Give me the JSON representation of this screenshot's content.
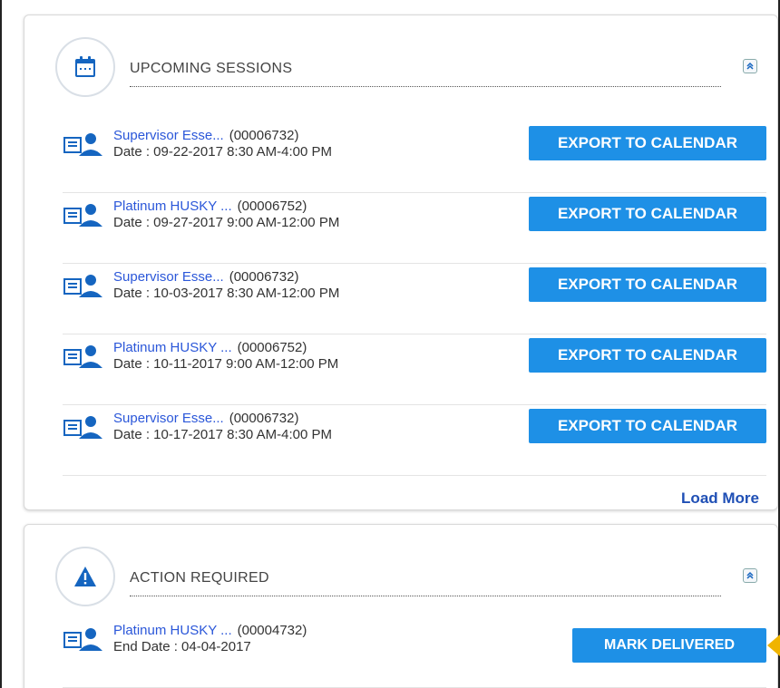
{
  "upcoming": {
    "title": "UPCOMING SESSIONS",
    "sessions": [
      {
        "name": "Supervisor Esse...",
        "code": "(00006732)",
        "date": "Date : 09-22-2017 8:30 AM-4:00 PM",
        "button": "EXPORT TO CALENDAR"
      },
      {
        "name": "Platinum HUSKY ...",
        "code": "(00006752)",
        "date": "Date : 09-27-2017 9:00 AM-12:00 PM",
        "button": "EXPORT TO CALENDAR"
      },
      {
        "name": "Supervisor Esse...",
        "code": "(00006732)",
        "date": "Date : 10-03-2017 8:30 AM-12:00 PM",
        "button": "EXPORT TO CALENDAR"
      },
      {
        "name": "Platinum HUSKY ...",
        "code": "(00006752)",
        "date": "Date : 10-11-2017 9:00 AM-12:00 PM",
        "button": "EXPORT TO CALENDAR"
      },
      {
        "name": "Supervisor Esse...",
        "code": "(00006732)",
        "date": "Date : 10-17-2017 8:30 AM-4:00 PM",
        "button": "EXPORT TO CALENDAR"
      }
    ],
    "load_more": "Load More"
  },
  "action": {
    "title": "ACTION REQUIRED",
    "items": [
      {
        "name": "Platinum HUSKY ...",
        "code": "(00004732)",
        "date": "End Date : 04-04-2017",
        "button": "MARK DELIVERED"
      }
    ]
  },
  "colors": {
    "button_blue": "#1e90e6",
    "link_blue": "#2b57d9",
    "icon_blue": "#1565c0",
    "pointer_yellow": "#f0b400"
  }
}
